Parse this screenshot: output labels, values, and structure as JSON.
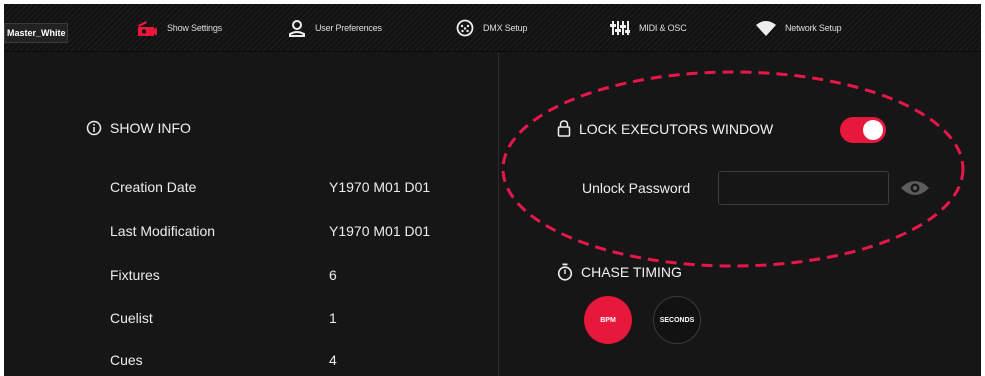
{
  "nav": {
    "user": "Master_White",
    "items": [
      {
        "label": "Show Settings",
        "icon": "show-settings-icon"
      },
      {
        "label": "User Preferences",
        "icon": "user-icon"
      },
      {
        "label": "DMX Setup",
        "icon": "dmx-connector-icon"
      },
      {
        "label": "MIDI & OSC",
        "icon": "midi-sliders-icon"
      },
      {
        "label": "Network Setup",
        "icon": "wifi-icon"
      }
    ]
  },
  "show_info": {
    "title": "SHOW INFO",
    "rows": [
      {
        "label": "Creation Date",
        "value": "Y1970 M01 D01"
      },
      {
        "label": "Last Modification",
        "value": "Y1970 M01 D01"
      },
      {
        "label": "Fixtures",
        "value": "6"
      },
      {
        "label": "Cuelist",
        "value": "1"
      },
      {
        "label": "Cues",
        "value": "4"
      }
    ]
  },
  "lock": {
    "title": "LOCK EXECUTORS WINDOW",
    "enabled": true,
    "password_label": "Unlock Password",
    "password_value": ""
  },
  "chase": {
    "title": "CHASE TIMING",
    "options": [
      "BPM",
      "SECONDS"
    ],
    "selected": "BPM"
  },
  "colors": {
    "accent": "#e8173c",
    "background": "#161616",
    "annotation": "#e8174a"
  }
}
